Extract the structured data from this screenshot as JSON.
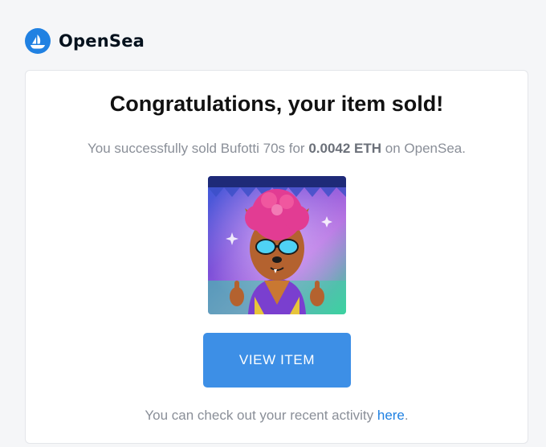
{
  "brand": {
    "name": "OpenSea",
    "logo_icon": "opensea-boat-icon",
    "color": "#2081e2"
  },
  "headline": "Congratulations, your item sold!",
  "sale": {
    "prefix": "You successfully sold Bufotti 70s for ",
    "price": "0.0042 ETH",
    "suffix": " on OpenSea."
  },
  "item_image": {
    "icon": "nft-artwork-image"
  },
  "view_button": {
    "label": "VIEW ITEM",
    "color": "#3d8fe6"
  },
  "footer": {
    "prefix": "You can check out your recent activity ",
    "link_label": "here",
    "suffix": "."
  }
}
